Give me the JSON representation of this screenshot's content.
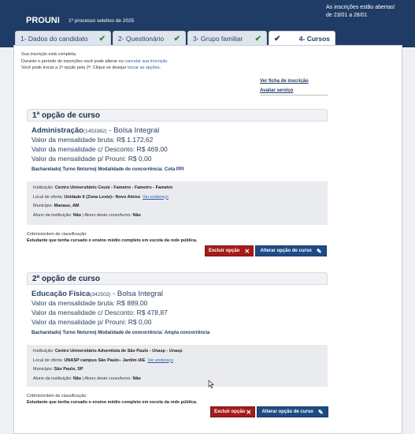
{
  "header": {
    "brand": "PROUNI",
    "edition": "1º processo seletivo de 2025",
    "notice_line1": "As inscrições estão abertas!",
    "notice_line2": "de 23/01 a 28/01"
  },
  "tabs": [
    {
      "label": "1- Dados do candidato"
    },
    {
      "label": "2- Questionário"
    },
    {
      "label": "3- Grupo familiar"
    },
    {
      "label": "4- Cursos"
    }
  ],
  "messages": {
    "line1": "Sua inscrição está completa.",
    "line2_prefix": "Durante o período de inscrições você pode alterar ou ",
    "line2_link": "cancelar sua inscrição",
    "line3_prefix": "Você pode trocar a 1ª opção pela 2ª. Clique se desejar ",
    "line3_link": "trocar as opções",
    "line3_suffix": "."
  },
  "side_links": {
    "ficha": "Ver ficha de inscrição",
    "avaliar": "Avaliar serviço"
  },
  "options": [
    {
      "title": "1ª opção de curso",
      "course": "Administração",
      "code": "(1453382)",
      "bolsa": " - Bolsa Integral",
      "mensalidade_bruta": "Valor da mensalidade bruta: R$ 1.172,62",
      "mensalidade_desconto": "Valor da mensalidade c/ Desconto: R$ 469,00",
      "mensalidade_prouni": "Valor da mensalidade p/ Prouni: R$ 0,00",
      "detalhes": "Bacharelado| Turno Noturno| Modalidade de concorrência: Cota PPI",
      "instituicao_label": "Instituição:",
      "instituicao": "Centro Universitário Ceuni - Fametro - Fametro - Fametro",
      "local_label": "Local de oferta:",
      "local": "Unidade 6 (Zona Leste)– Novo Aleixo",
      "ver_endereco": "Ver endereço",
      "municipio_label": "Município:",
      "municipio": "Manaus, AM",
      "aluno_inst_label": "Aluno da instituição:",
      "aluno_inst": "Não",
      "aluno_curso_label": "| Aluno deste curso/turno:",
      "aluno_curso": "Não",
      "criterio_label": "Critério/ordem de classificação:",
      "criterio": "Estudante que tenha cursado o ensino médio completo em escola da rede pública.",
      "excluir": "Excluir opção",
      "alterar": "Alterar opção de curso"
    },
    {
      "title": "2ª opção de curso",
      "course": "Educação Física",
      "code": "(342502)",
      "bolsa": " - Bolsa Integral",
      "mensalidade_bruta": "Valor da mensalidade bruta: R$ 889,00",
      "mensalidade_desconto": "Valor da mensalidade c/ Desconto: R$ 478,87",
      "mensalidade_prouni": "Valor da mensalidade p/ Prouni: R$ 0,00",
      "detalhes": "Bacharelado| Turno Noturno| Modalidade de concorrência: Ampla concorrência",
      "instituicao_label": "Instituição:",
      "instituicao": "Centro Universitário Adventista de São Paulo - Unasp - Unasp",
      "local_label": "Local de oferta:",
      "local": "UNASP campus São Paulo– Jardim IAE",
      "ver_endereco": "Ver endereço",
      "municipio_label": "Município:",
      "municipio": "São Paulo, SP",
      "aluno_inst_label": "Aluno da instituição:",
      "aluno_inst": "Não",
      "aluno_curso_label": "| Aluno deste curso/turno:",
      "aluno_curso": "Não",
      "criterio_label": "Critério/ordem de classificação:",
      "criterio": "Estudante que tenha cursado o ensino médio completo em escola da rede pública.",
      "excluir": "Excluir opção",
      "alterar": "Alterar opção de curso"
    }
  ],
  "icons": {
    "check": "check-icon",
    "close": "close-icon",
    "pencil": "pencil-icon"
  }
}
